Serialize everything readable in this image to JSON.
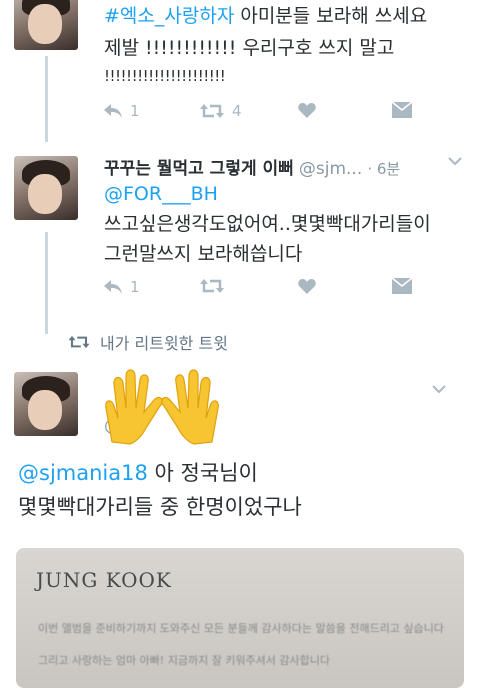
{
  "tweet1": {
    "hashtag": "#엑소_사랑하자",
    "line1_rest": " 아미분들 보라해 쓰세요",
    "line2": "제발 !!!!!!!!!!!! 우리구호 쓰지 말고",
    "line3": "!!!!!!!!!!!!!!!!!!!!!!",
    "reply_count": "1",
    "retweet_count": "4"
  },
  "tweet2": {
    "name": "꾸꾸는 뭘먹고 그렇게 이뻐",
    "handle": "@sjm...",
    "time": "· 6분",
    "mention": "@FOR___BH",
    "line1": "쓰고싶은생각도없어여..몇몇빡대가리들이",
    "line2": "그런말쓰지 보라해씁니다",
    "reply_count": "1"
  },
  "retweet_banner": {
    "label": "내가 리트윗한 트윗"
  },
  "tweet3": {
    "handle_fragment": "@",
    "mention": "@sjmania18",
    "line1_rest": " 아 정국님이",
    "line2": "몇몇빡대가리들 중 한명이었구나"
  },
  "photo": {
    "title": "JUNG KOOK",
    "line1": "이번 앨범을 준비하기까지 도와주신 모든 분들께 감사하다는 말씀을 전해드리고 싶습니다",
    "line2": "그리고 사랑하는 엄마 아빠! 지금까지 잘 키워주셔서 감사합니다"
  },
  "colors": {
    "link": "#1da1f2",
    "icon": "#aab8c2",
    "text": "#292f33",
    "handle": "#8899a6"
  }
}
